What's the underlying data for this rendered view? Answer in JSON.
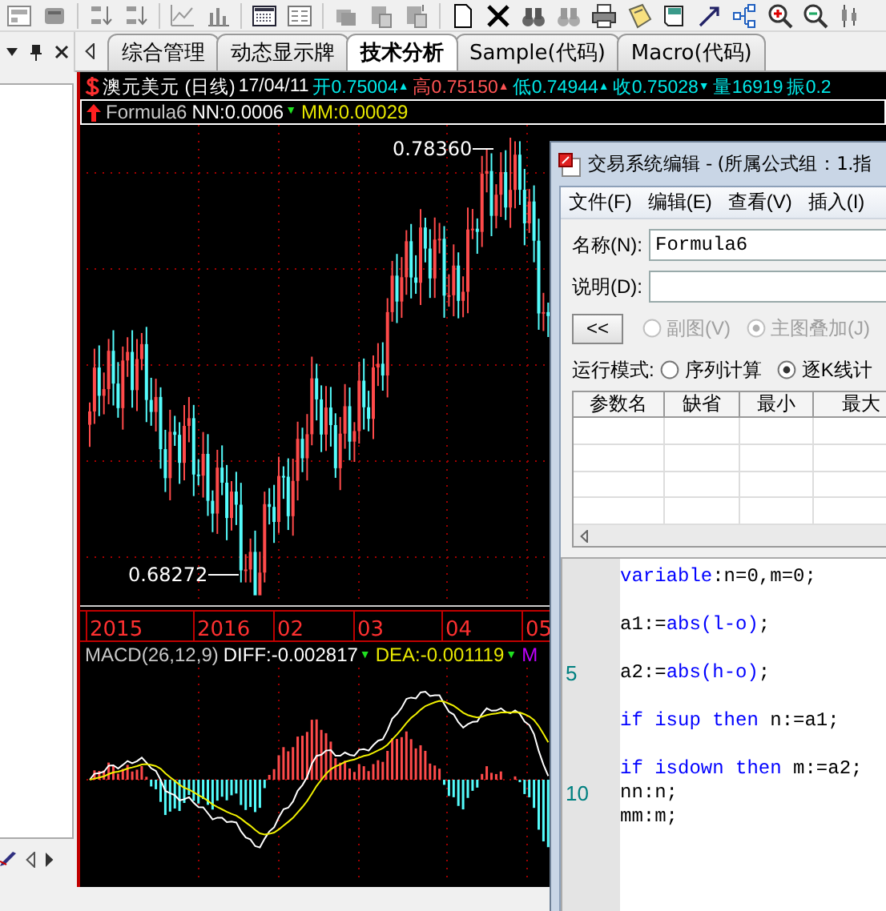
{
  "tabs": [
    {
      "label": "综合管理",
      "selected": false
    },
    {
      "label": "动态显示牌",
      "selected": false
    },
    {
      "label": "技术分析",
      "selected": true
    },
    {
      "label": "Sample(代码)",
      "selected": false
    },
    {
      "label": "Macro(代码)",
      "selected": false
    }
  ],
  "quote": {
    "symbol": "澳元美元 (日线)",
    "date": "17/04/11",
    "fields": [
      {
        "text": "开0.75004",
        "color": "#00e8e8",
        "arrow": "▲"
      },
      {
        "text": "高0.75150",
        "color": "#ff5454",
        "arrow": "▲"
      },
      {
        "text": "低0.74944",
        "color": "#00e8e8",
        "arrow": "▲"
      },
      {
        "text": "收0.75028",
        "color": "#00e8e8",
        "arrow": "▼"
      },
      {
        "text": "量16919",
        "color": "#00e8e8"
      },
      {
        "text": "振0.2",
        "color": "#00e8e8"
      }
    ]
  },
  "formula_line": {
    "name": "Formula6",
    "values": [
      {
        "text": "NN:0.0006",
        "color": "#ffffff",
        "arrow": "▼"
      },
      {
        "text": "MM:0.00029",
        "color": "#e8e800"
      }
    ]
  },
  "chart": {
    "high_label": "0.78360",
    "low_label": "0.68272"
  },
  "time_axis": [
    "2015",
    "2016",
    "02",
    "03",
    "04",
    "05"
  ],
  "macd": {
    "title": "MACD(26,12,9)",
    "values": [
      {
        "text": "DIFF:-0.002817",
        "color": "#ffffff",
        "arrow": "▼"
      },
      {
        "text": "DEA:-0.001119",
        "color": "#e8e800",
        "arrow": "▼"
      },
      {
        "text": "M",
        "color": "#c000ff"
      }
    ]
  },
  "dialog": {
    "title": "交易系统编辑 - (所属公式组：1.指",
    "menu": [
      "文件(F)",
      "编辑(E)",
      "查看(V)",
      "插入(I)"
    ],
    "name_label": "名称(N):",
    "name_value": "Formula6",
    "desc_label": "说明(D):",
    "collapse_button": "<<",
    "chart_type": [
      {
        "label": "副图(V)",
        "selected": false,
        "disabled": true
      },
      {
        "label": "主图叠加(J)",
        "selected": true,
        "disabled": true
      }
    ],
    "run_mode": {
      "label": "运行模式:",
      "options": [
        {
          "label": "序列计算",
          "selected": false
        },
        {
          "label": "逐K线计",
          "selected": true
        }
      ]
    },
    "params_table": {
      "columns": [
        "参数名",
        "缺省",
        "最小",
        "最大"
      ]
    },
    "code": [
      {
        "kind": "code",
        "tokens": [
          {
            "text": "variable",
            "kind": "keyword"
          },
          {
            "text": ":n=0,m=0;",
            "kind": "plain"
          }
        ]
      },
      {
        "kind": "blank"
      },
      {
        "kind": "code",
        "tokens": [
          {
            "text": "a1:=",
            "kind": "plain"
          },
          {
            "text": "abs(l-o)",
            "kind": "keyword"
          },
          {
            "text": ";",
            "kind": "plain"
          }
        ]
      },
      {
        "kind": "blank"
      },
      {
        "kind": "code",
        "number": "5",
        "tokens": [
          {
            "text": "a2:=",
            "kind": "plain"
          },
          {
            "text": "abs(h-o)",
            "kind": "keyword"
          },
          {
            "text": ";",
            "kind": "plain"
          }
        ]
      },
      {
        "kind": "blank"
      },
      {
        "kind": "code",
        "tokens": [
          {
            "text": "if isup then",
            "kind": "keyword"
          },
          {
            "text": " n:=a1;",
            "kind": "plain"
          }
        ]
      },
      {
        "kind": "blank"
      },
      {
        "kind": "code",
        "tokens": [
          {
            "text": "if isdown then",
            "kind": "keyword"
          },
          {
            "text": " m:=a2;",
            "kind": "plain"
          }
        ]
      },
      {
        "kind": "code",
        "number": "10",
        "tokens": [
          {
            "text": "nn:n;",
            "kind": "plain"
          }
        ]
      },
      {
        "kind": "code",
        "tokens": [
          {
            "text": "mm:m;",
            "kind": "plain"
          }
        ]
      }
    ]
  }
}
